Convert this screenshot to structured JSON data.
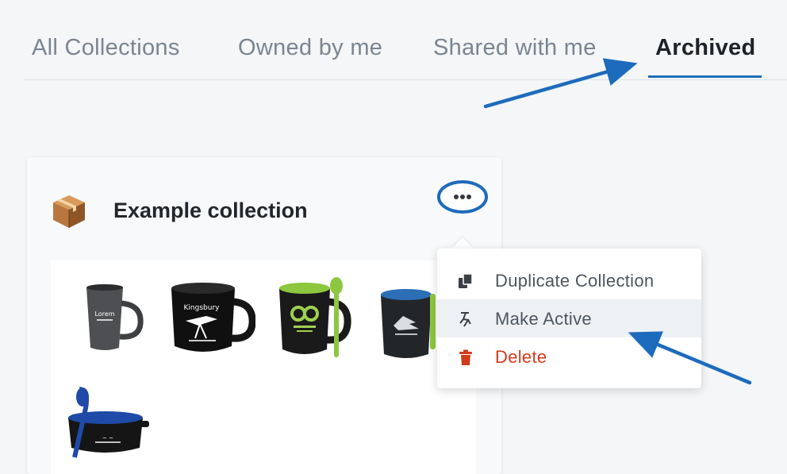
{
  "tabs": [
    {
      "label": "All Collections",
      "active": false
    },
    {
      "label": "Owned by me",
      "active": false
    },
    {
      "label": "Shared with me",
      "active": false
    },
    {
      "label": "Archived",
      "active": true
    }
  ],
  "collection": {
    "title": "Example collection",
    "icon": "package-box-icon",
    "more_icon": "more-options-icon",
    "products": [
      {
        "name": "mug-grey",
        "imprint": "Lorem"
      },
      {
        "name": "mug-black",
        "imprint": "Kingsbury"
      },
      {
        "name": "mug-green-spoon",
        "imprint": ""
      },
      {
        "name": "mug-blue-interior",
        "imprint": ""
      },
      {
        "name": "bowl-with-spork",
        "imprint": ""
      }
    ]
  },
  "context_menu": {
    "items": [
      {
        "label": "Duplicate Collection",
        "icon": "copy-icon",
        "variant": "default"
      },
      {
        "label": "Make Active",
        "icon": "activate-icon",
        "variant": "hover"
      },
      {
        "label": "Delete",
        "icon": "trash-icon",
        "variant": "danger"
      }
    ]
  },
  "colors": {
    "accent": "#1c6fb8",
    "danger": "#d23a1c",
    "text_muted": "#7b8590",
    "text_dark": "#23272b",
    "annotation": "#1d6bbc"
  }
}
